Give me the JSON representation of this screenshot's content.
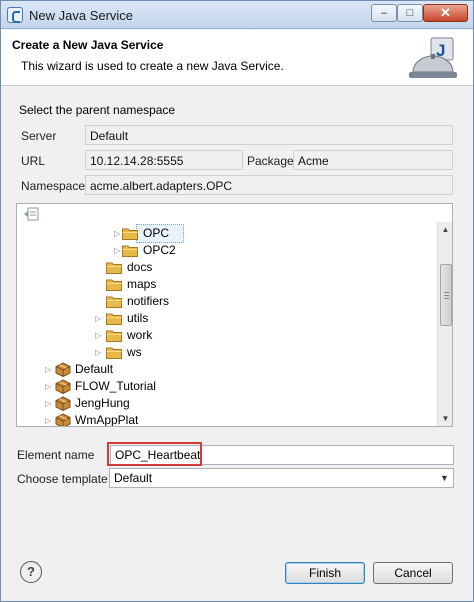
{
  "window": {
    "title": "New Java Service",
    "minimize": "–",
    "maximize": "□",
    "close": "✕"
  },
  "header": {
    "title": "Create a New Java Service",
    "description": "This wizard is used to create a new Java Service.",
    "icon": "service-bell-icon"
  },
  "namespace": {
    "section_label": "Select the parent namespace",
    "server_label": "Server",
    "server_value": "Default",
    "url_label": "URL",
    "url_value": "10.12.14.28:5555",
    "package_label": "Package",
    "package_value": "Acme",
    "namespace_label": "Namespace",
    "namespace_value": "acme.albert.adapters.OPC"
  },
  "tree": {
    "items": [
      {
        "label": "OPC",
        "kind": "folder",
        "selected": true
      },
      {
        "label": "OPC2",
        "kind": "folder"
      },
      {
        "label": "docs",
        "kind": "folder"
      },
      {
        "label": "maps",
        "kind": "folder"
      },
      {
        "label": "notifiers",
        "kind": "folder"
      },
      {
        "label": "utils",
        "kind": "folder"
      },
      {
        "label": "work",
        "kind": "folder"
      },
      {
        "label": "ws",
        "kind": "folder"
      },
      {
        "label": "Default",
        "kind": "package"
      },
      {
        "label": "FLOW_Tutorial",
        "kind": "package"
      },
      {
        "label": "JengHung",
        "kind": "package"
      },
      {
        "label": "WmAppPlat",
        "kind": "package"
      }
    ]
  },
  "form": {
    "element_name_label": "Element name",
    "element_name_value": "OPC_Heartbeat",
    "template_label": "Choose template",
    "template_value": "Default"
  },
  "footer": {
    "help": "?",
    "finish_label": "Finish",
    "cancel_label": "Cancel"
  },
  "colors": {
    "highlight": "#d43a3a",
    "folder": "#e8b84a",
    "package": "#c98b3a"
  }
}
